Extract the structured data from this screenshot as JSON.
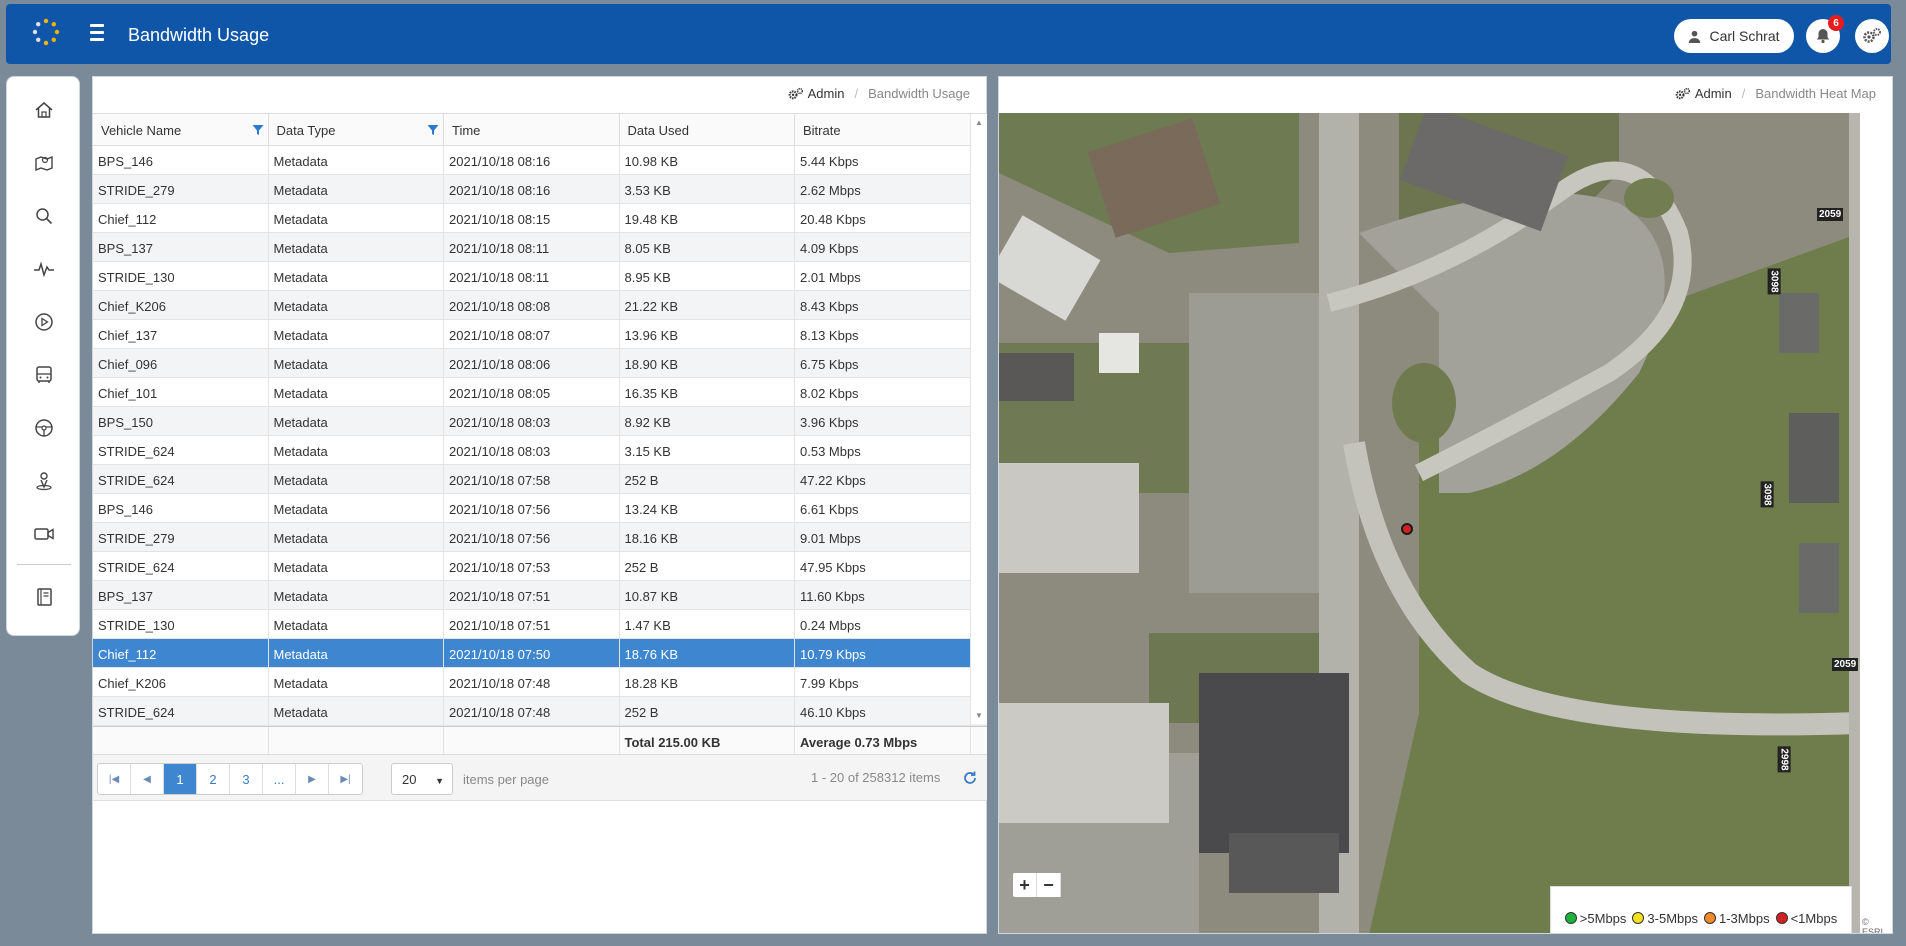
{
  "header": {
    "title": "Bandwidth Usage",
    "user_name": "Carl Schrat",
    "notification_count": "6"
  },
  "sidebar": {
    "items": [
      {
        "icon": "home-icon"
      },
      {
        "icon": "map-icon"
      },
      {
        "icon": "search-icon"
      },
      {
        "icon": "pulse-icon"
      },
      {
        "icon": "play-icon"
      },
      {
        "icon": "bus-icon"
      },
      {
        "icon": "steering-wheel-icon"
      },
      {
        "icon": "person-pin-icon"
      },
      {
        "icon": "camera-icon"
      },
      {
        "icon": "book-icon"
      }
    ]
  },
  "left_panel": {
    "breadcrumb": {
      "admin": "Admin",
      "page": "Bandwidth Usage"
    },
    "columns": [
      "Vehicle Name",
      "Data Type",
      "Time",
      "Data Used",
      "Bitrate"
    ],
    "rows": [
      [
        "BPS_146",
        "Metadata",
        "2021/10/18 08:16",
        "10.98 KB",
        "5.44 Kbps"
      ],
      [
        "STRIDE_279",
        "Metadata",
        "2021/10/18 08:16",
        "3.53 KB",
        "2.62 Mbps"
      ],
      [
        "Chief_112",
        "Metadata",
        "2021/10/18 08:15",
        "19.48 KB",
        "20.48 Kbps"
      ],
      [
        "BPS_137",
        "Metadata",
        "2021/10/18 08:11",
        "8.05 KB",
        "4.09 Kbps"
      ],
      [
        "STRIDE_130",
        "Metadata",
        "2021/10/18 08:11",
        "8.95 KB",
        "2.01 Mbps"
      ],
      [
        "Chief_K206",
        "Metadata",
        "2021/10/18 08:08",
        "21.22 KB",
        "8.43 Kbps"
      ],
      [
        "Chief_137",
        "Metadata",
        "2021/10/18 08:07",
        "13.96 KB",
        "8.13 Kbps"
      ],
      [
        "Chief_096",
        "Metadata",
        "2021/10/18 08:06",
        "18.90 KB",
        "6.75 Kbps"
      ],
      [
        "Chief_101",
        "Metadata",
        "2021/10/18 08:05",
        "16.35 KB",
        "8.02 Kbps"
      ],
      [
        "BPS_150",
        "Metadata",
        "2021/10/18 08:03",
        "8.92 KB",
        "3.96 Kbps"
      ],
      [
        "STRIDE_624",
        "Metadata",
        "2021/10/18 08:03",
        "3.15 KB",
        "0.53 Mbps"
      ],
      [
        "STRIDE_624",
        "Metadata",
        "2021/10/18 07:58",
        "252 B",
        "47.22 Kbps"
      ],
      [
        "BPS_146",
        "Metadata",
        "2021/10/18 07:56",
        "13.24 KB",
        "6.61 Kbps"
      ],
      [
        "STRIDE_279",
        "Metadata",
        "2021/10/18 07:56",
        "18.16 KB",
        "9.01 Mbps"
      ],
      [
        "STRIDE_624",
        "Metadata",
        "2021/10/18 07:53",
        "252 B",
        "47.95 Kbps"
      ],
      [
        "BPS_137",
        "Metadata",
        "2021/10/18 07:51",
        "10.87 KB",
        "11.60 Kbps"
      ],
      [
        "STRIDE_130",
        "Metadata",
        "2021/10/18 07:51",
        "1.47 KB",
        "0.24 Mbps"
      ],
      [
        "Chief_112",
        "Metadata",
        "2021/10/18 07:50",
        "18.76 KB",
        "10.79 Kbps"
      ],
      [
        "Chief_K206",
        "Metadata",
        "2021/10/18 07:48",
        "18.28 KB",
        "7.99 Kbps"
      ],
      [
        "STRIDE_624",
        "Metadata",
        "2021/10/18 07:48",
        "252 B",
        "46.10 Kbps"
      ]
    ],
    "selected_row": 17,
    "footer": {
      "total": "Total 215.00 KB",
      "average": "Average 0.73 Mbps"
    },
    "pager": {
      "pages": [
        "1",
        "2",
        "3",
        "..."
      ],
      "active_page": "1",
      "per_page": "20",
      "per_page_label": "items per page",
      "info": "1 - 20 of 258312 items"
    }
  },
  "right_panel": {
    "breadcrumb": {
      "admin": "Admin",
      "page": "Bandwidth Heat Map"
    },
    "legend": [
      {
        "label": ">5Mbps",
        "color": "#1bb33a"
      },
      {
        "label": "3-5Mbps",
        "color": "#f2e21e"
      },
      {
        "label": "1-3Mbps",
        "color": "#f08a2a"
      },
      {
        "label": "<1Mbps",
        "color": "#d32020"
      }
    ],
    "attribution": "© ESRI",
    "map_labels": [
      "2059",
      "3098",
      "3098",
      "2059",
      "2998"
    ],
    "zoom_in": "+",
    "zoom_out": "−"
  }
}
